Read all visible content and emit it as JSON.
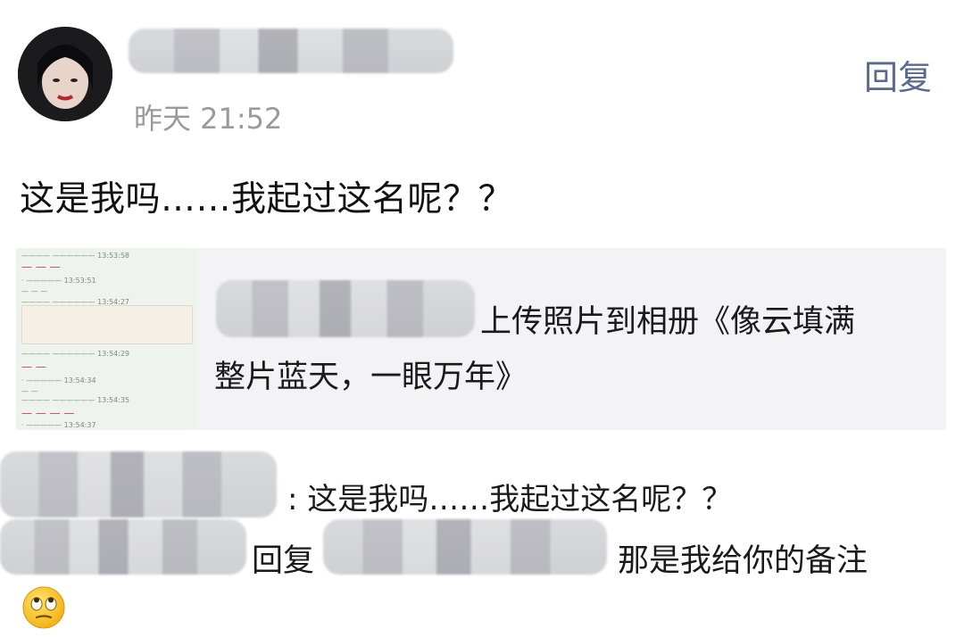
{
  "post": {
    "timestamp": "昨天 21:52",
    "reply_label": "回复",
    "text": "这是我吗……我起过这名呢？？"
  },
  "shared_album": {
    "action_text": "上传照片到相册《像云填满整片蓝天，一眼万年》",
    "line1": "上传照片到相册《像云填满",
    "line2": "整片蓝天，一眼万年》"
  },
  "comments": [
    {
      "separator": ":",
      "text": "这是我吗……我起过这名呢？？"
    },
    {
      "reply_word": "回复",
      "text": "那是我给你的备注"
    }
  ],
  "reaction": {
    "icon": "eye-roll-emoji-icon"
  }
}
